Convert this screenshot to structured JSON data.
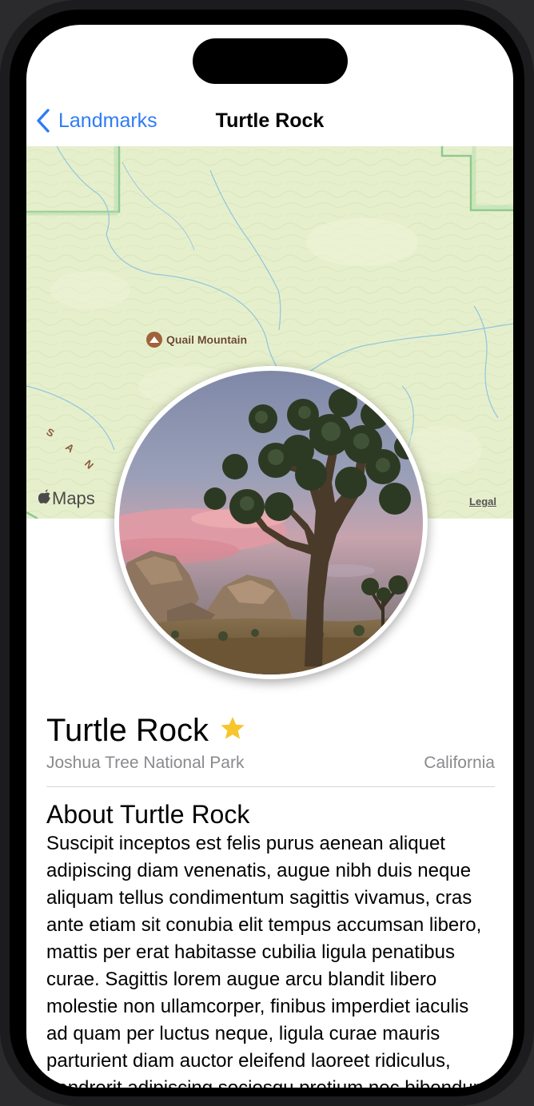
{
  "nav": {
    "back_label": "Landmarks",
    "title": "Turtle Rock",
    "back_icon": "chevron-left-icon"
  },
  "map": {
    "poi_label": "Quail Mountain",
    "poi_icon": "mountain-icon",
    "range_label": "SAN B",
    "maps_brand": "Maps",
    "legal_label": "Legal"
  },
  "landmark": {
    "name": "Turtle Rock",
    "favorite": true,
    "favorite_icon": "star-icon",
    "favorite_color": "#f7c52e",
    "park": "Joshua Tree National Park",
    "state": "California"
  },
  "about": {
    "heading": "About Turtle Rock",
    "body": "Suscipit inceptos est felis purus aenean aliquet adipiscing diam venenatis, augue nibh duis neque aliquam tellus condimentum sagittis vivamus, cras ante etiam sit conubia elit tempus accumsan libero, mattis per erat habitasse cubilia ligula penatibus curae. Sagittis lorem augue arcu blandit libero molestie non ullamcorper, finibus imperdiet iaculis ad quam per luctus neque, ligula curae mauris parturient diam auctor eleifend laoreet ridiculus, hendrerit adipiscing sociosqu pretium nec bibendum."
  },
  "colors": {
    "accent": "#2e7cf6",
    "secondary_text": "#8a8a8e",
    "map_land": "#e6efcc"
  }
}
